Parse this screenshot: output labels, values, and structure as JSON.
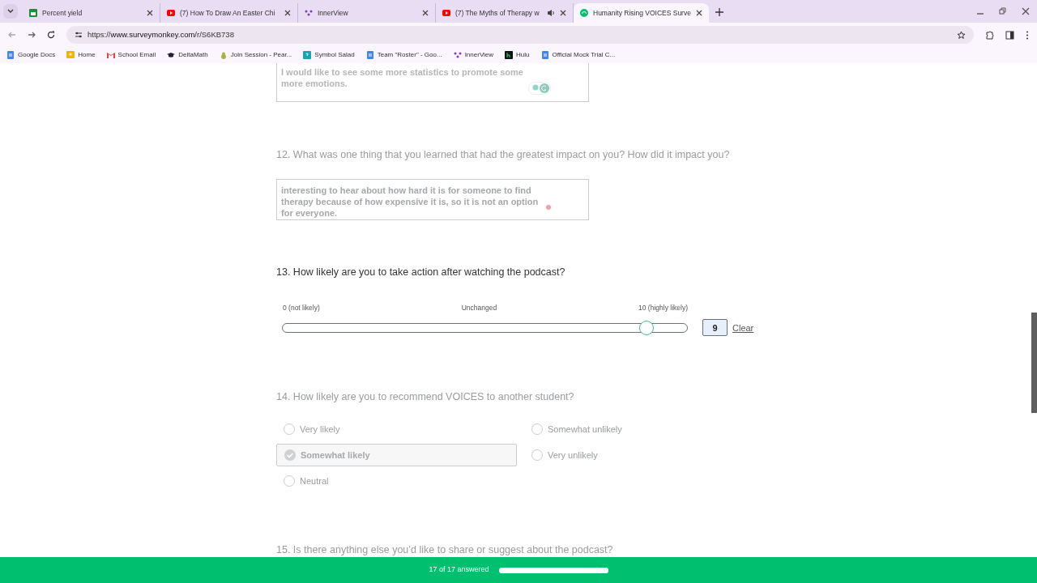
{
  "browser": {
    "tabs": [
      {
        "title": "Percent yield",
        "kind": "sheets",
        "selected": false,
        "audio": false
      },
      {
        "title": "(7) How To Draw An Easter Chi",
        "kind": "youtube",
        "selected": false,
        "audio": false
      },
      {
        "title": "InnerView",
        "kind": "innerview",
        "selected": false,
        "audio": false
      },
      {
        "title": "(7) The Myths of Therapy w",
        "kind": "youtube",
        "selected": false,
        "audio": true
      },
      {
        "title": "Humanity Rising VOICES Surve",
        "kind": "surveymonkey",
        "selected": true,
        "audio": false
      }
    ],
    "url_prefix": "https://",
    "url_host": "www.surveymonkey.com",
    "url_path": "/r/S6KB738",
    "bookmarks": [
      {
        "label": "Google Docs",
        "kind": "docs"
      },
      {
        "label": "Home",
        "kind": "classroom"
      },
      {
        "label": "School Email",
        "kind": "gmail"
      },
      {
        "label": "DeltaMath",
        "kind": "deltamath"
      },
      {
        "label": "Join Session - Pear...",
        "kind": "pear"
      },
      {
        "label": "Symbol Salad",
        "kind": "symbol"
      },
      {
        "label": "Team \"Roster\" - Goo...",
        "kind": "docs"
      },
      {
        "label": "InnerView",
        "kind": "innerview"
      },
      {
        "label": "Hulu",
        "kind": "hulu"
      },
      {
        "label": "Official Mock Trial C...",
        "kind": "docs"
      }
    ]
  },
  "questions": [
    {
      "kind": "text",
      "answer_lines": [
        "I would like to see some more statistics to promote some",
        "more emotions."
      ],
      "top_cut": true
    },
    {
      "kind": "text",
      "title": "12. What was one thing that you learned that had the greatest impact on you? How did it impact you?",
      "active": false,
      "answer_lines": [
        "interesting to hear about how hard it is for someone to find",
        "therapy because of how expensive it is, so it is not an option",
        "for everyone."
      ]
    },
    {
      "kind": "slider",
      "title": "13. How likely are you to take action after watching the podcast?",
      "active": true,
      "min_label": "0 (not likely)",
      "mid_label": "Unchanged",
      "max_label": "10 (highly likely)",
      "level": 0.9,
      "value": "9",
      "clear": "Clear"
    },
    {
      "kind": "choice",
      "title": "14. How likely are you to recommend VOICES to another student?",
      "active": false,
      "options": [
        {
          "label": "Very likely",
          "selected": false
        },
        {
          "label": "Somewhat likely",
          "selected": true
        },
        {
          "label": "Neutral",
          "selected": false
        },
        {
          "label": "Somewhat unlikely",
          "selected": false
        },
        {
          "label": "Very unlikely",
          "selected": false
        }
      ]
    },
    {
      "kind": "text",
      "title": "15. Is there anything else you’d like to share or suggest about the podcast?",
      "active": false
    }
  ],
  "footer": {
    "progress_text": "17 of 17 answered",
    "level": 1.0
  }
}
